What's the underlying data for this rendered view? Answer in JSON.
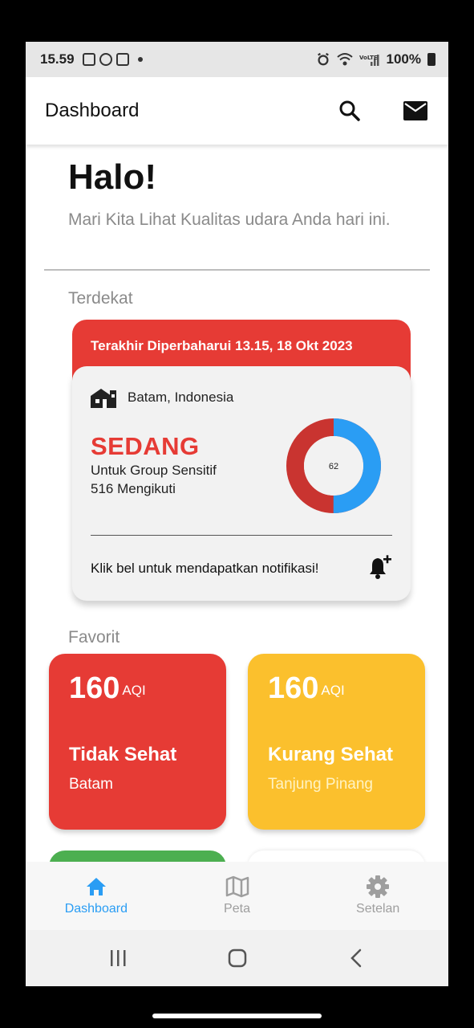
{
  "status_bar": {
    "time": "15.59",
    "battery": "100%"
  },
  "app_bar": {
    "title": "Dashboard",
    "search_icon": "search-icon",
    "mail_icon": "mail-icon"
  },
  "greeting": {
    "title": "Halo!",
    "subtitle": "Mari Kita Lihat Kualitas udara Anda hari ini."
  },
  "nearest": {
    "section_label": "Terdekat",
    "last_updated": "Terakhir Diperbaharui 13.15, 18 Okt 2023",
    "location": "Batam, Indonesia",
    "status": "SEDANG",
    "group": "Untuk Group Sensitif",
    "followers": "516 Mengikuti",
    "aqi": "62",
    "aqi_fraction": 0.62,
    "notify_text": "Klik bel untuk mendapatkan notifikasi!",
    "colors": {
      "header": "#e63b35",
      "ring_main": "#2a9df4",
      "ring_rest": "#c93430"
    }
  },
  "favorites": {
    "section_label": "Favorit",
    "items": [
      {
        "aqi": "160",
        "unit": "AQI",
        "status": "Tidak Sehat",
        "city": "Batam",
        "color": "#e63b35"
      },
      {
        "aqi": "160",
        "unit": "AQI",
        "status": "Kurang Sehat",
        "city": "Tanjung Pinang",
        "color": "#fbc02d"
      }
    ]
  },
  "bottom_nav": {
    "items": [
      {
        "label": "Dashboard",
        "icon": "home-icon",
        "active": true
      },
      {
        "label": "Peta",
        "icon": "map-icon",
        "active": false
      },
      {
        "label": "Setelan",
        "icon": "gear-icon",
        "active": false
      }
    ]
  }
}
